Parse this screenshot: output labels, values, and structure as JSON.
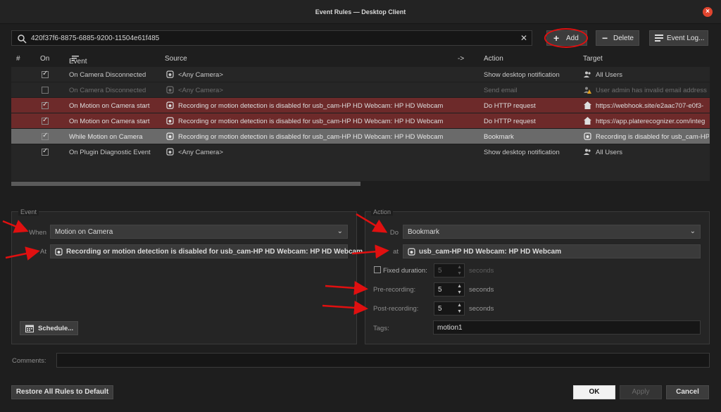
{
  "window": {
    "title": "Event Rules — Desktop Client"
  },
  "search": {
    "value": "420f37f6-8875-6885-9200-11504e61f485"
  },
  "toolbar": {
    "add_label": "Add",
    "delete_label": "Delete",
    "log_label": "Event Log..."
  },
  "table": {
    "columns": {
      "num": "#",
      "on": "On",
      "event": "Event",
      "source": "Source",
      "arrow": "->",
      "action": "Action",
      "target": "Target"
    },
    "rows": [
      {
        "on": true,
        "event": "On Camera Disconnected",
        "source": "<Any Camera>",
        "action": "Show desktop notification",
        "target": "All Users",
        "style": "normal",
        "target_icon": "users-icon"
      },
      {
        "on": false,
        "event": "On Camera Disconnected",
        "source": "<Any Camera>",
        "action": "Send email",
        "target": "User admin has invalid email address",
        "style": "dim",
        "target_icon": "user-warning-icon"
      },
      {
        "on": true,
        "event": "On Motion on Camera start",
        "source": "Recording or motion detection is disabled for usb_cam-HP HD Webcam: HP HD Webcam",
        "action": "Do HTTP request",
        "target": "https://webhook.site/e2aac707-e0f3-",
        "style": "red",
        "target_icon": "server-icon"
      },
      {
        "on": true,
        "event": "On Motion on Camera start",
        "source": "Recording or motion detection is disabled for usb_cam-HP HD Webcam: HP HD Webcam",
        "action": "Do HTTP request",
        "target": "https://app.platerecognizer.com/integ",
        "style": "red",
        "target_icon": "server-icon"
      },
      {
        "on": true,
        "event": "While Motion on Camera",
        "source": "Recording or motion detection is disabled for usb_cam-HP HD Webcam: HP HD Webcam",
        "action": "Bookmark",
        "target": "Recording is disabled for usb_cam-HP",
        "style": "selected",
        "target_icon": "camera-icon"
      },
      {
        "on": true,
        "event": "On Plugin Diagnostic Event",
        "source": "<Any Camera>",
        "action": "Show desktop notification",
        "target": "All Users",
        "style": "normal",
        "target_icon": "users-icon"
      }
    ]
  },
  "event_panel": {
    "legend": "Event",
    "when_label": "When",
    "when_value": "Motion on Camera",
    "at_label": "At",
    "at_value": "Recording or motion detection is disabled for usb_cam-HP HD Webcam: HP HD Webcam",
    "schedule_label": "Schedule..."
  },
  "action_panel": {
    "legend": "Action",
    "do_label": "Do",
    "do_value": "Bookmark",
    "at_label": "at",
    "at_value": "usb_cam-HP HD Webcam: HP HD Webcam",
    "fixed_duration_label": "Fixed duration:",
    "fixed_duration_value": "5",
    "fixed_duration_checked": false,
    "pre_recording_label": "Pre-recording:",
    "pre_recording_value": "5",
    "post_recording_label": "Post-recording:",
    "post_recording_value": "5",
    "seconds_unit": "seconds",
    "tags_label": "Tags:",
    "tags_value": "motion1"
  },
  "comments": {
    "label": "Comments:",
    "value": ""
  },
  "footer": {
    "restore_label": "Restore All Rules to Default",
    "ok_label": "OK",
    "apply_label": "Apply",
    "cancel_label": "Cancel"
  },
  "colors": {
    "row_red": "#6d2a2a",
    "row_selected": "#6a6a6a",
    "annotation": "#e01010",
    "close": "#e0452f"
  }
}
